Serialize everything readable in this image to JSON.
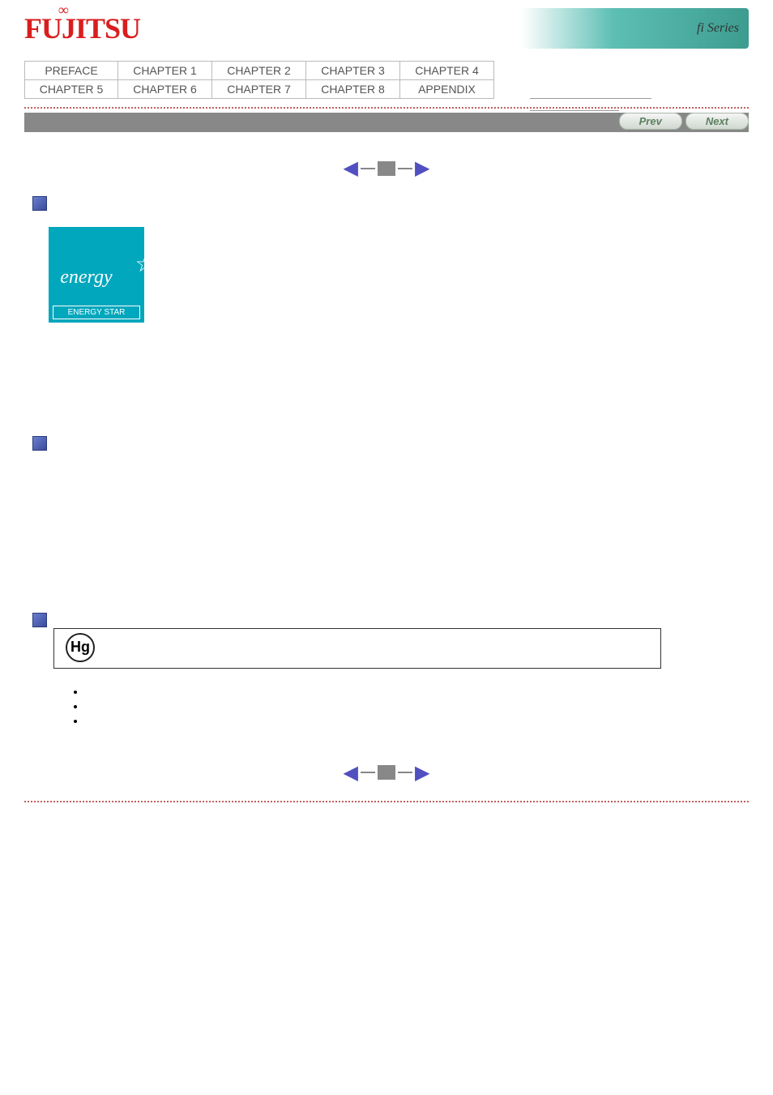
{
  "brand": {
    "logo_text": "FUJITSU",
    "series_text": "fi Series"
  },
  "nav": [
    "PREFACE",
    "CHAPTER 1",
    "CHAPTER 2",
    "CHAPTER 3",
    "CHAPTER 4",
    "CHAPTER 5",
    "CHAPTER 6",
    "CHAPTER 7",
    "CHAPTER 8",
    "APPENDIX"
  ],
  "buttons": {
    "prev": "Prev",
    "next": "Next"
  },
  "energy_star": {
    "script": "energy",
    "label": "ENERGY STAR"
  },
  "hg": {
    "symbol": "Hg"
  },
  "bullets": [
    "",
    "",
    ""
  ]
}
